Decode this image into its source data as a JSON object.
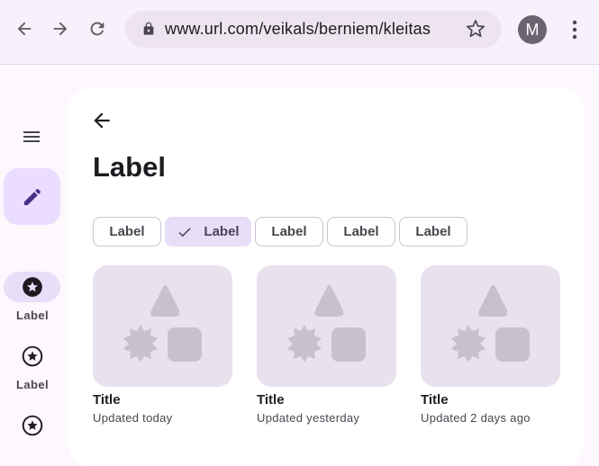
{
  "browser": {
    "url": "www.url.com/veikals/berniem/kleitas",
    "avatar_initial": "M"
  },
  "rail": {
    "items": [
      {
        "label": "Label",
        "active": true
      },
      {
        "label": "Label",
        "active": false
      },
      {
        "label": "",
        "active": false
      }
    ]
  },
  "page": {
    "title": "Label",
    "chips": [
      {
        "label": "Label",
        "selected": false
      },
      {
        "label": "Label",
        "selected": true
      },
      {
        "label": "Label",
        "selected": false
      },
      {
        "label": "Label",
        "selected": false
      },
      {
        "label": "Label",
        "selected": false
      }
    ],
    "tiles": [
      {
        "title": "Title",
        "subtitle": "Updated today"
      },
      {
        "title": "Title",
        "subtitle": "Updated yesterday"
      },
      {
        "title": "Title",
        "subtitle": "Updated 2 days ago"
      }
    ]
  },
  "colors": {
    "accent_container": "#eaddff",
    "secondary_container": "#e8def8",
    "placeholder_bg": "#e9e2ee",
    "placeholder_shape": "#c9c0cd"
  }
}
